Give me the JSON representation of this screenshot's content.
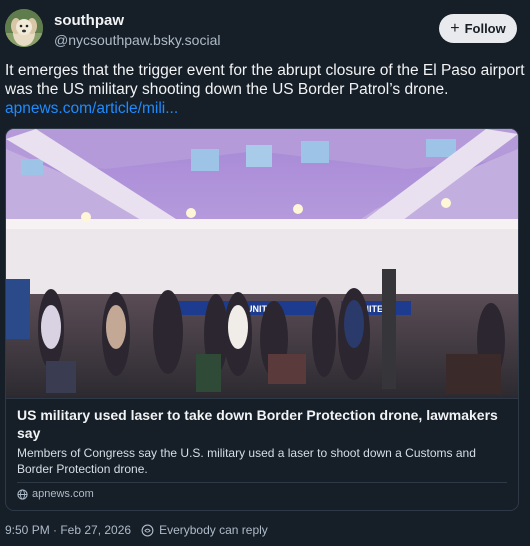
{
  "author": {
    "display_name": "southpaw",
    "handle": "@nycsouthpaw.bsky.social"
  },
  "follow_button": {
    "label": "Follow"
  },
  "post": {
    "text": "It emerges that the trigger event for the abrupt closure of the El Paso airport was the US military shooting down the US Border Patrol’s drone.",
    "link": "apnews.com/article/mili..."
  },
  "embed": {
    "title": "US military used laser to take down Border Protection drone, lawmakers say",
    "description": "Members of Congress say the U.S. military used a laser to shoot down a Customs and Border Protection drone.",
    "domain": "apnews.com",
    "image_signage": [
      "UNITED",
      "UNITED"
    ]
  },
  "meta": {
    "timestamp": "9:50 PM · Feb 27, 2026",
    "reply_setting": "Everybody can reply"
  },
  "colors": {
    "background": "#161e27",
    "link": "#1e8cff",
    "follow_button_bg": "#e8eaed",
    "muted_text": "#aebbc9"
  },
  "icons": [
    "avatar-dog-icon",
    "plus-icon",
    "globe-icon",
    "reply-settings-icon"
  ]
}
